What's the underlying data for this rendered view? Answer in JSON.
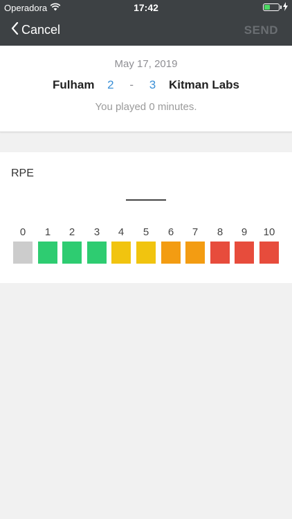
{
  "status": {
    "carrier": "Operadora",
    "time": "17:42",
    "battery_level": 0.38
  },
  "nav": {
    "back_label": "Cancel",
    "send_label": "SEND"
  },
  "match": {
    "date": "May 17, 2019",
    "home_team": "Fulham",
    "home_score": "2",
    "separator": "-",
    "away_score": "3",
    "away_team": "Kitman Labs",
    "played_text": "You played 0 minutes."
  },
  "rpe": {
    "label": "RPE",
    "selected_value": "",
    "scale": [
      {
        "value": "0",
        "color": "#cccccc"
      },
      {
        "value": "1",
        "color": "#2ecc71"
      },
      {
        "value": "2",
        "color": "#2ecc71"
      },
      {
        "value": "3",
        "color": "#2ecc71"
      },
      {
        "value": "4",
        "color": "#f1c40f"
      },
      {
        "value": "5",
        "color": "#f1c40f"
      },
      {
        "value": "6",
        "color": "#f39c12"
      },
      {
        "value": "7",
        "color": "#f39c12"
      },
      {
        "value": "8",
        "color": "#e74c3c"
      },
      {
        "value": "9",
        "color": "#e74c3c"
      },
      {
        "value": "10",
        "color": "#e74c3c"
      }
    ]
  }
}
